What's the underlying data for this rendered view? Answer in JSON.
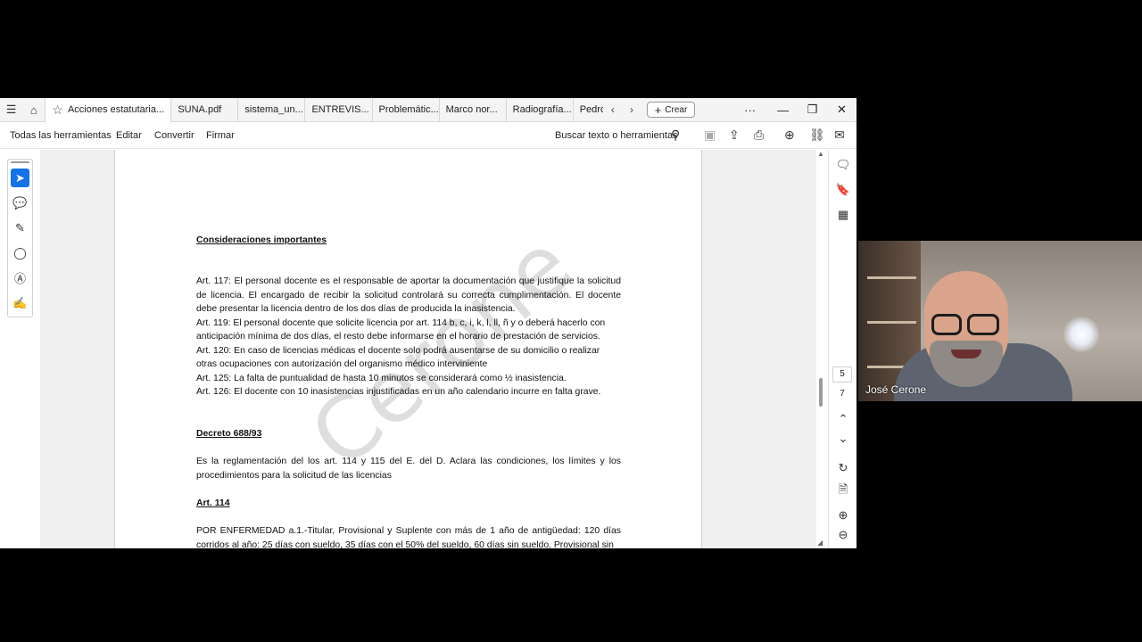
{
  "tabs": [
    {
      "label": "Acciones estatutaria...",
      "active": true
    },
    {
      "label": "SUNA.pdf"
    },
    {
      "label": "sistema_un..."
    },
    {
      "label": "ENTREVIS..."
    },
    {
      "label": "Problemátic..."
    },
    {
      "label": "Marco nor..."
    },
    {
      "label": "Radiografía..."
    },
    {
      "label": "Pedro"
    }
  ],
  "tabbar": {
    "create_label": "Crear",
    "more": "···"
  },
  "toolbar": {
    "all_tools": "Todas las herramientas",
    "edit": "Editar",
    "convert": "Convertir",
    "sign": "Firmar",
    "search_label": "Buscar texto o herramientas"
  },
  "document": {
    "heading1": "Consideraciones importantes",
    "art117": "Art. 117: El personal docente es el responsable de aportar la documentación que justifique la solicitud de licencia. El encargado de recibir la solicitud controlará su correcta cumplimentación. El docente debe presentar la licencia dentro de los dos días de producida la inasistencia.",
    "art119_a": "Art. 119: El personal docente que solicite licencia por art. 114 b, c, i, k, l, ll, ñ y o  deberá hacerlo con",
    "art119_b": "anticipación mínima de dos días, el resto debe informarse en el horario de prestación de servicios.",
    "art120_a": "Art. 120: En caso de licencias médicas el docente solo podrá ausentarse de su domicilio o realizar",
    "art120_b": "otras ocupaciones con autorización del organismo médico interviniente",
    "art125": "Art. 125: La falta de puntualidad de hasta 10 minutos se considerará como ½ inasistencia.",
    "art126": "Art. 126: El docente  con 10 inasistencias injustificadas en un año calendario incurre en falta grave.",
    "heading2": "Decreto 688/93",
    "decreto_text": "Es la reglamentación del los art. 114 y 115 del E. del D. Aclara las condiciones, los límites y los procedimientos para la solicitud de las licencias",
    "heading3": "Art. 114",
    "art114_text": "POR ENFERMEDAD a.1.-Titular, Provisional y Suplente con más de 1 año de antigüedad: 120 días corridos al año: 25 días con sueldo, 35 días con el 50% del sueldo, 60 días sin sueldo. Provisional sin",
    "watermark": "Cerone"
  },
  "navigation": {
    "current_page": "5",
    "total_pages": "7"
  },
  "video": {
    "participant_name": "José Cerone"
  },
  "colors": {
    "accent": "#1473e6",
    "background": "#000000"
  }
}
